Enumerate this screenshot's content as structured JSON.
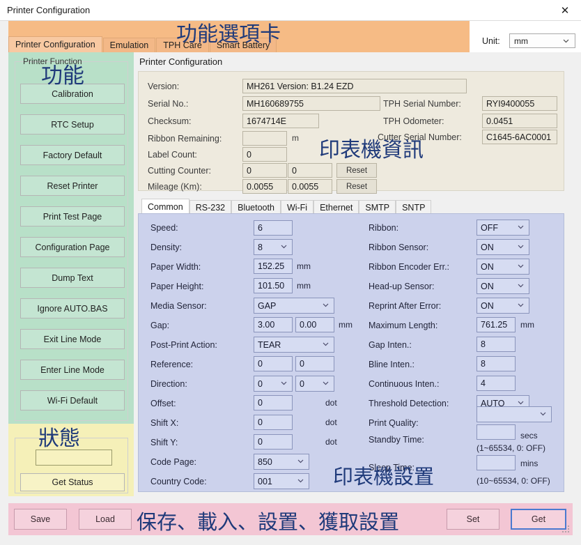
{
  "window": {
    "title": "Printer Configuration",
    "close_icon": "close-icon"
  },
  "header": {
    "tabs": [
      {
        "label": "Printer Configuration",
        "active": true
      },
      {
        "label": "Emulation",
        "active": false
      },
      {
        "label": "TPH Care",
        "active": false
      },
      {
        "label": "Smart Battery",
        "active": false
      }
    ],
    "unit_label": "Unit:",
    "unit_value": "mm"
  },
  "annotations": {
    "tabs": "功能選項卡",
    "function": "功能",
    "info": "印表機資訊",
    "status": "狀態",
    "settings": "印表機設置",
    "bottom": "保存、載入、設置、獲取設置"
  },
  "sidebar": {
    "group_title": "Printer Function",
    "buttons": [
      {
        "label": "Calibration"
      },
      {
        "label": "RTC Setup"
      },
      {
        "label": "Factory Default"
      },
      {
        "label": "Reset Printer"
      },
      {
        "label": "Print Test Page"
      },
      {
        "label": "Configuration Page"
      },
      {
        "label": "Dump Text"
      },
      {
        "label": "Ignore AUTO.BAS"
      },
      {
        "label": "Exit Line Mode"
      },
      {
        "label": "Enter Line Mode"
      },
      {
        "label": "Wi-Fi Default"
      }
    ],
    "status": {
      "value": "",
      "button_label": "Get Status"
    }
  },
  "main": {
    "title": "Printer Configuration",
    "info": {
      "version_label": "Version:",
      "version_value": "MH261 Version: B1.24 EZD",
      "serial_label": "Serial No.:",
      "serial_value": "MH160689755",
      "checksum_label": "Checksum:",
      "checksum_value": "1674714E",
      "ribbon_remaining_label": "Ribbon Remaining:",
      "ribbon_remaining_value": "",
      "ribbon_remaining_unit": "m",
      "label_count_label": "Label Count:",
      "label_count_value": "0",
      "cutting_counter_label": "Cutting Counter:",
      "cutting_counter_value1": "0",
      "cutting_counter_value2": "0",
      "cutting_counter_reset": "Reset",
      "mileage_label": "Mileage (Km):",
      "mileage_value1": "0.0055",
      "mileage_value2": "0.0055",
      "mileage_reset": "Reset",
      "tph_serial_label": "TPH Serial Number:",
      "tph_serial_value": "RYI9400055",
      "tph_odometer_label": "TPH Odometer:",
      "tph_odometer_value": "0.0451",
      "cutter_serial_label": "Cutter Serial Number:",
      "cutter_serial_value": "C1645-6AC0001"
    },
    "tabs": [
      {
        "label": "Common",
        "active": true
      },
      {
        "label": "RS-232",
        "active": false
      },
      {
        "label": "Bluetooth",
        "active": false
      },
      {
        "label": "Wi-Fi",
        "active": false
      },
      {
        "label": "Ethernet",
        "active": false
      },
      {
        "label": "SMTP",
        "active": false
      },
      {
        "label": "SNTP",
        "active": false
      }
    ],
    "settings_left": {
      "speed_label": "Speed:",
      "speed_value": "6",
      "density_label": "Density:",
      "density_value": "8",
      "paper_width_label": "Paper Width:",
      "paper_width_value": "152.25",
      "paper_width_unit": "mm",
      "paper_height_label": "Paper Height:",
      "paper_height_value": "101.50",
      "paper_height_unit": "mm",
      "media_sensor_label": "Media Sensor:",
      "media_sensor_value": "GAP",
      "gap_label": "Gap:",
      "gap_value1": "3.00",
      "gap_value2": "0.00",
      "gap_unit": "mm",
      "post_print_label": "Post-Print Action:",
      "post_print_value": "TEAR",
      "reference_label": "Reference:",
      "reference_value1": "0",
      "reference_value2": "0",
      "direction_label": "Direction:",
      "direction_value1": "0",
      "direction_value2": "0",
      "offset_label": "Offset:",
      "offset_value": "0",
      "offset_unit": "dot",
      "shift_x_label": "Shift X:",
      "shift_x_value": "0",
      "shift_x_unit": "dot",
      "shift_y_label": "Shift Y:",
      "shift_y_value": "0",
      "shift_y_unit": "dot",
      "code_page_label": "Code Page:",
      "code_page_value": "850",
      "country_code_label": "Country Code:",
      "country_code_value": "001"
    },
    "settings_right": {
      "ribbon_label": "Ribbon:",
      "ribbon_value": "OFF",
      "ribbon_sensor_label": "Ribbon Sensor:",
      "ribbon_sensor_value": "ON",
      "ribbon_encoder_label": "Ribbon Encoder Err.:",
      "ribbon_encoder_value": "ON",
      "headup_sensor_label": "Head-up Sensor:",
      "headup_sensor_value": "ON",
      "reprint_label": "Reprint After Error:",
      "reprint_value": "ON",
      "max_length_label": "Maximum Length:",
      "max_length_value": "761.25",
      "max_length_unit": "mm",
      "gap_inten_label": "Gap Inten.:",
      "gap_inten_value": "8",
      "bline_inten_label": "Bline Inten.:",
      "bline_inten_value": "8",
      "continuous_inten_label": "Continuous Inten.:",
      "continuous_inten_value": "4",
      "threshold_label": "Threshold Detection:",
      "threshold_value": "AUTO",
      "print_quality_label": "Print Quality:",
      "print_quality_value": "",
      "standby_label": "Standby Time:",
      "standby_value": "",
      "standby_unit": "secs",
      "standby_hint": "(1~65534, 0: OFF)",
      "sleep_label": "Sleep Time:",
      "sleep_value": "",
      "sleep_unit": "mins",
      "sleep_hint": "(10~65534, 0: OFF)"
    }
  },
  "footer": {
    "save_label": "Save",
    "load_label": "Load",
    "set_label": "Set",
    "get_label": "Get"
  },
  "colors": {
    "tab_overlay": "#f6bb85",
    "function_overlay": "#b8e0c8",
    "status_overlay": "#f5f0b8",
    "settings_panel": "#ccd2ec",
    "info_panel": "#eeeade",
    "footer_overlay": "#f3c6d4",
    "annotation_text": "#1f3a7a",
    "focus_border": "#4a7ad0"
  }
}
